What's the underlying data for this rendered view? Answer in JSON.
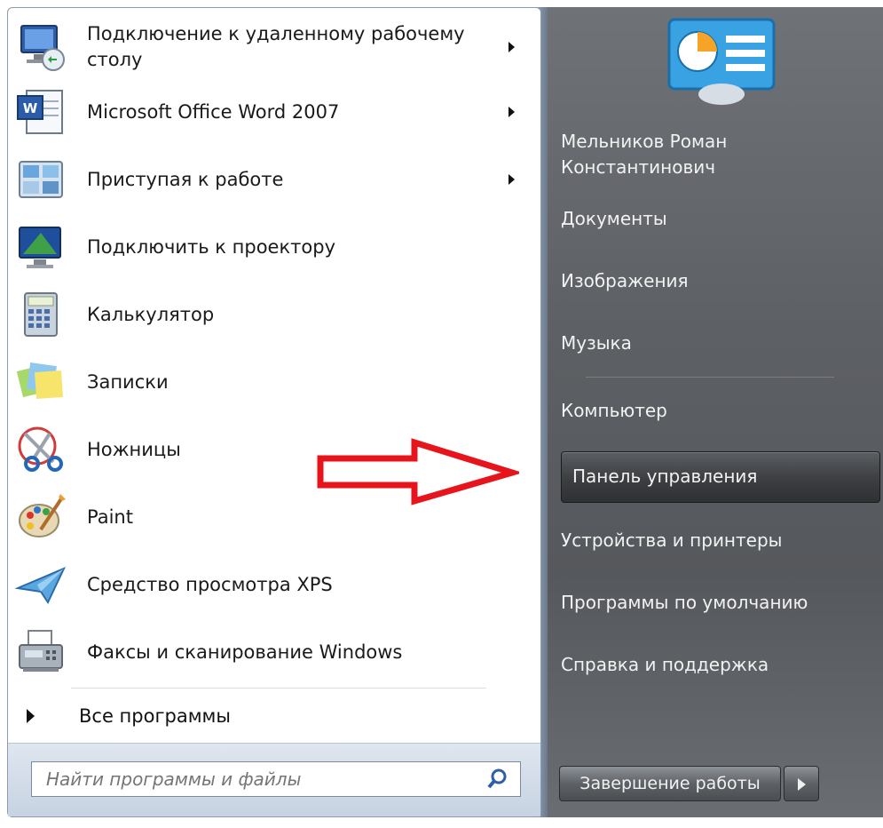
{
  "left_items": [
    {
      "label_line1": "Подключение к удаленному рабочему",
      "label_line2": "столу",
      "icon": "remote-desktop-icon",
      "has_submenu": true
    },
    {
      "label": "Microsoft Office Word 2007",
      "icon": "word-icon",
      "has_submenu": true
    },
    {
      "label": "Приступая к работе",
      "icon": "getting-started-icon",
      "has_submenu": true
    },
    {
      "label": "Подключить к проектору",
      "icon": "projector-icon",
      "has_submenu": false
    },
    {
      "label": "Калькулятор",
      "icon": "calculator-icon",
      "has_submenu": false
    },
    {
      "label": "Записки",
      "icon": "sticky-notes-icon",
      "has_submenu": false
    },
    {
      "label": "Ножницы",
      "icon": "snipping-tool-icon",
      "has_submenu": false
    },
    {
      "label": "Paint",
      "icon": "paint-icon",
      "has_submenu": false
    },
    {
      "label": "Средство просмотра XPS",
      "icon": "xps-viewer-icon",
      "has_submenu": false
    },
    {
      "label": "Факсы и сканирование Windows",
      "icon": "fax-scan-icon",
      "has_submenu": false
    }
  ],
  "all_programs": "Все программы",
  "search": {
    "placeholder": "Найти программы и файлы",
    "icon": "search-icon"
  },
  "right_items": {
    "user_line1": "Мельников Роман",
    "user_line2": "Константинович",
    "documents": "Документы",
    "pictures": "Изображения",
    "music": "Музыка",
    "computer": "Компьютер",
    "control_panel": "Панель управления",
    "devices": "Устройства и принтеры",
    "defaults": "Программы по умолчанию",
    "help": "Справка и поддержка"
  },
  "shutdown": {
    "label": "Завершение работы"
  },
  "colors": {
    "highlight_arrow": "#e8141b",
    "right_panel": "#5d6064"
  }
}
